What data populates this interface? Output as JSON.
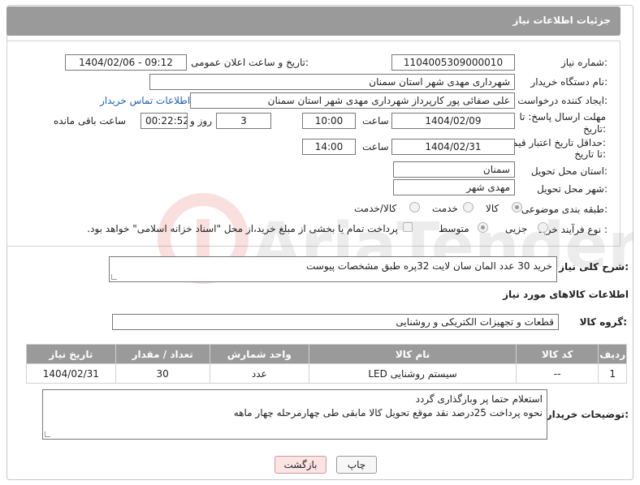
{
  "page_title": "جزئیات اطلاعات نیاز",
  "fields": {
    "need_number_label": "شماره نیاز:",
    "need_number": "1104005309000010",
    "announce_label": "تاریخ و ساعت اعلان عمومی:",
    "announce_value": "1404/02/06 - 09:12",
    "buyer_org_label": "نام دستگاه خریدار:",
    "buyer_org": "شهرداری مهدی شهر استان سمنان",
    "creator_label": "ایجاد کننده درخواست:",
    "creator": "علی صفائی پور کارپرداز شهرداری مهدی شهر استان سمنان",
    "contact_link": "اطلاعات تماس خریدار",
    "deadline_label_line1": "مهلت ارسال پاسخ: تا",
    "deadline_label_line2": "تاریخ:",
    "deadline_date": "1404/02/09",
    "time_label": "ساعت",
    "deadline_time": "10:00",
    "days_value": "3",
    "days_label": "روز و",
    "remaining_time": "00:22:52",
    "remaining_label": "ساعت باقی مانده",
    "validity_label_line1": "حداقل تاریخ اعتبار قیمت:",
    "validity_label_line2": "تا تاریخ:",
    "validity_date": "1404/02/31",
    "validity_time_label": "ساعت",
    "validity_time": "14:00",
    "province_label": "استان محل تحویل:",
    "province": "سمنان",
    "city_label": "شهر محل تحویل:",
    "city": "مهدی شهر",
    "category_label": "طبقه بندی موضوعی:",
    "category_options": [
      "کالا",
      "خدمت",
      "کالا/خدمت"
    ],
    "process_label": "نوع فرآیند خرید :",
    "process_options": [
      "جزیی",
      "متوسط"
    ],
    "payment_note": "پرداخت تمام یا بخشی از مبلغ خرید،از محل \"اسناد خزانه اسلامی\" خواهد بود."
  },
  "description": {
    "label": "شرح کلی نیاز:",
    "value": "خرید 30 عدد المان سان لایت 32پره طبق مشخصات پیوست"
  },
  "goods_section_title": "اطلاعات کالاهای مورد نیاز",
  "goods_group": {
    "label": "گروه کالا:",
    "value": "قطعات و تجهیزات الکتریکی و روشنایی"
  },
  "table": {
    "headers": [
      "ردیف",
      "کد کالا",
      "نام کالا",
      "واحد شمارش",
      "تعداد / مقدار",
      "تاریخ نیاز"
    ],
    "rows": [
      [
        "1",
        "--",
        "سیستم روشنایی LED",
        "عدد",
        "30",
        "1404/02/31"
      ]
    ]
  },
  "buyer_notes": {
    "label": "توضیحات خریدار:",
    "line1": "استعلام حتما پر وبارگذاری گردد",
    "line2": "نحوه پرداخت 25درصد نقد موقع تحویل کالا مابقی طی چهارمرحله چهار ماهه"
  },
  "buttons": {
    "print": "چاپ",
    "back": "بازگشت"
  },
  "watermark_text": "AriaTender.neT"
}
